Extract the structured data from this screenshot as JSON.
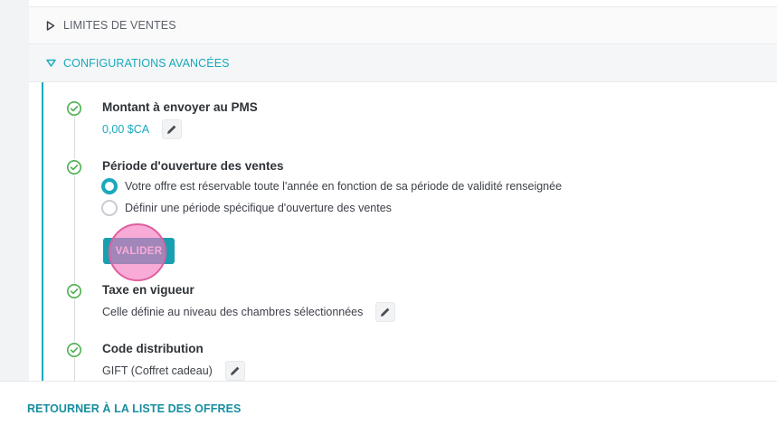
{
  "sections": {
    "limits_label": "LIMITES DE VENTES",
    "config_label": "CONFIGURATIONS AVANCÉES"
  },
  "steps": [
    {
      "title": "Montant à envoyer au PMS",
      "value": "0,00 $CA"
    },
    {
      "title": "Période d'ouverture des ventes",
      "options": [
        {
          "label": "Votre offre est réservable toute l'année en fonction de sa période de validité renseignée",
          "selected": true
        },
        {
          "label": "Définir une période spécifique d'ouverture des ventes",
          "selected": false
        }
      ],
      "validate_label": "VALIDER"
    },
    {
      "title": "Taxe en vigueur",
      "value": "Celle définie au niveau des chambres sélectionnées"
    },
    {
      "title": "Code distribution",
      "value": "GIFT (Coffret cadeau)"
    }
  ],
  "footer": {
    "back_link": "RETOURNER À LA LISTE DES OFFRES"
  },
  "colors": {
    "accent": "#19a9bc",
    "button": "#1a9fb1",
    "success": "#4caf50",
    "click_marker": "#f478be"
  },
  "icons": {
    "collapsed": "caret-right-icon",
    "expanded": "caret-down-icon",
    "step_done": "check-circle-icon",
    "edit": "pencil-icon"
  }
}
